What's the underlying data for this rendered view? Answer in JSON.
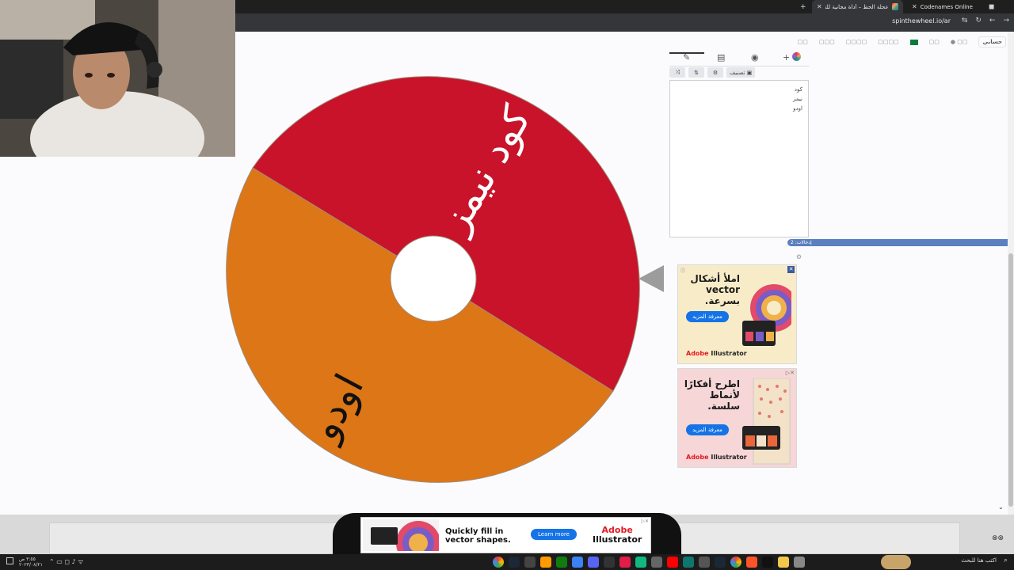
{
  "browser": {
    "tabs": [
      {
        "title": "Codenames Online"
      },
      {
        "title": "عجلة الحظ – أداة مجانية للتدوير ال..."
      }
    ],
    "url": "spinthewheel.io/ar",
    "icons": [
      "new-tab-icon",
      "minimize-icon",
      "maximize-icon",
      "close-icon",
      "reload-icon",
      "back-icon",
      "forward-icon"
    ]
  },
  "site_nav": {
    "items": [
      "حسابي",
      "عربي"
    ],
    "lang": "عربي"
  },
  "wheel": {
    "segments": [
      {
        "label": "كود نيمز",
        "color": "#c8132a",
        "text_color": "#ffffff"
      },
      {
        "label": "اودو",
        "color": "#dd7616",
        "text_color": "#111111"
      }
    ],
    "pointer_color": "#9c9c9c"
  },
  "editor": {
    "tabs": [
      "edit-icon",
      "clipboard-icon",
      "hide-icon",
      "add-color-icon"
    ],
    "tools": {
      "shuffle": "⤨",
      "sort": "⇅",
      "settings": "⚙",
      "image_label": "تصنيف"
    },
    "entries": [
      "كود نيمز",
      "اودو"
    ],
    "count_label": "إدخالات: 2"
  },
  "ads": {
    "ad1": {
      "title": "املأ أشكال vector بسرعة.",
      "cta": "معرفة المزيد",
      "brand_adobe": "Adobe",
      "brand_product": "Illustrator"
    },
    "ad2": {
      "title": "اطرح أفكارًا لأنماط سلسة.",
      "cta": "معرفة المزيد",
      "brand_adobe": "Adobe",
      "brand_product": "Illustrator"
    },
    "bottom": {
      "text_line1": "Quickly fill in",
      "text_line2": "vector shapes.",
      "cta": "Learn more",
      "brand_adobe": "Adobe",
      "brand_product": "Illustrator"
    }
  },
  "taskbar": {
    "time": "٣:٥٥ ص",
    "date": "٢٠٢٣/٠٨/٢١",
    "search_placeholder": "اكتب هنا للبحث"
  }
}
